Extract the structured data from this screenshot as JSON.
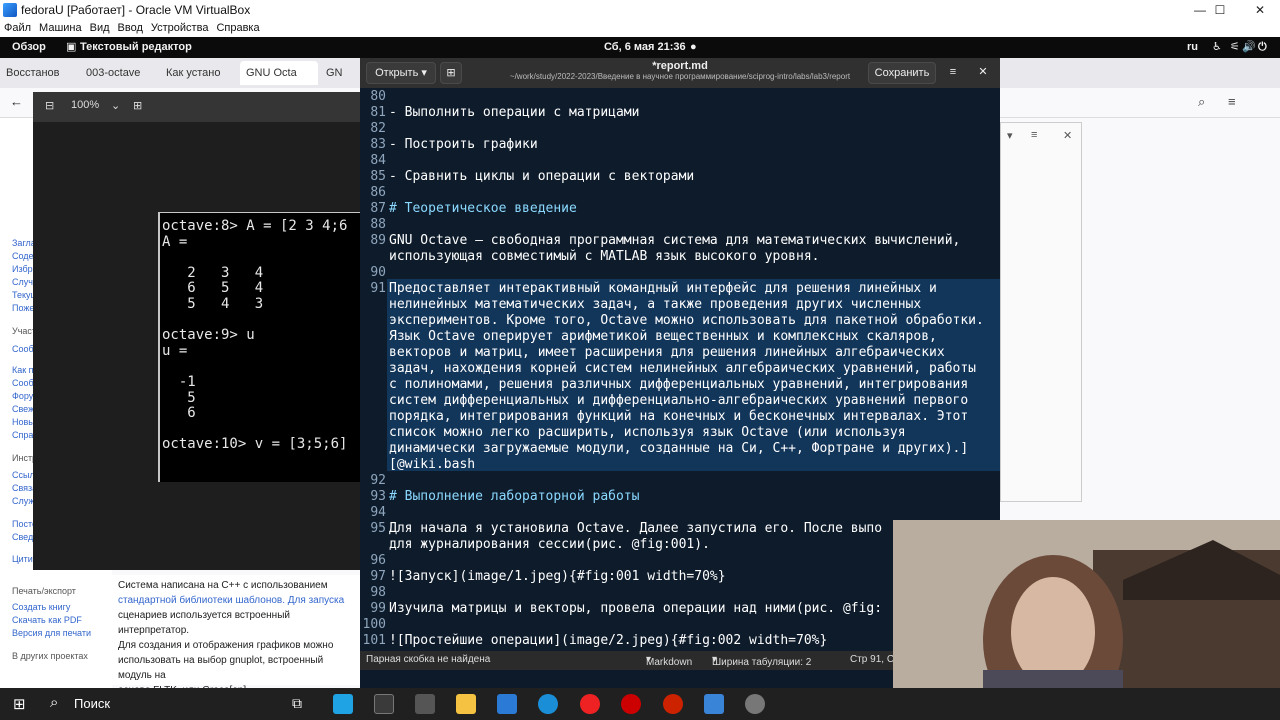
{
  "host": {
    "window_title": "fedoraU [Работает] - Oracle VM VirtualBox",
    "menu": [
      "Файл",
      "Машина",
      "Вид",
      "Ввод",
      "Устройства",
      "Справка"
    ]
  },
  "gnome": {
    "activities": "Обзор",
    "app_name": "Текстовый редактор",
    "clock": "Сб, 6 мая  21:36",
    "lang": "ru"
  },
  "firefox": {
    "tabs": [
      "Восстанов",
      "003-octave",
      "Как устано",
      "GNU Octa",
      "GN"
    ],
    "sidebar": [
      "Заглавная",
      "Содержание",
      "Избранные",
      "Случайная",
      "Текущие",
      "Пожертвовать",
      "Участие",
      "Сообщить",
      "Как править",
      "Сообщество",
      "Форум",
      "Свежие",
      "Новые",
      "Справка",
      "Инструменты",
      "Ссылки сюда",
      "Связанные",
      "Служебные",
      "Постоянная",
      "Сведения",
      "Цитировать",
      "Печать/экспорт",
      "Создать книгу",
      "Скачать как PDF",
      "Версия для печати",
      "В других проектах"
    ],
    "content_lines": [
      "Система написана на C++ с использованием",
      "стандартной библиотеки шаблонов. Для запуска",
      "сценариев используется встроенный интерпретатор.",
      "Для создания и отображения графиков можно",
      "использовать на выбор gnuplot, встроенный модуль на",
      "основе FLTK, или Grace[en]."
    ]
  },
  "viewer": {
    "zoom": "100%",
    "octave_text": "octave:8> A = [2 3 4;6\nA =\n\n   2   3   4\n   6   5   4\n   5   4   3\n\noctave:9> u\nu =\n\n  -1\n   5\n   6\n\noctave:10> v = [3;5;6]"
  },
  "gedit": {
    "open_label": "Открыть",
    "title": "*report.md",
    "path": "~/work/study/2022-2023/Введение в научное программирование/sciprog-intro/labs/lab3/report",
    "save_label": "Сохранить",
    "lines": [
      {
        "n": "80",
        "t": ""
      },
      {
        "n": "81",
        "t": "- Выполнить операции с матрицами"
      },
      {
        "n": "82",
        "t": ""
      },
      {
        "n": "83",
        "t": "- Построить графики"
      },
      {
        "n": "84",
        "t": ""
      },
      {
        "n": "85",
        "t": "- Сравнить циклы и операции с векторами"
      },
      {
        "n": "86",
        "t": ""
      },
      {
        "n": "87",
        "t": "# Теоретическое введение"
      },
      {
        "n": "88",
        "t": ""
      },
      {
        "n": "89",
        "t": "GNU Octave — свободная программная система для математических вычислений,"
      },
      {
        "n": "",
        "t": "использующая совместимый с MATLAB язык высокого уровня."
      },
      {
        "n": "90",
        "t": ""
      },
      {
        "n": "91",
        "t": "Предоставляет интерактивный командный интерфейс для решения линейных и"
      },
      {
        "n": "",
        "t": "нелинейных математических задач, а также проведения других численных"
      },
      {
        "n": "",
        "t": "экспериментов. Кроме того, Octave можно использовать для пакетной обработки."
      },
      {
        "n": "",
        "t": "Язык Octave оперирует арифметикой вещественных и комплексных скаляров,"
      },
      {
        "n": "",
        "t": "векторов и матриц, имеет расширения для решения линейных алгебраических"
      },
      {
        "n": "",
        "t": "задач, нахождения корней систем нелинейных алгебраических уравнений, работы"
      },
      {
        "n": "",
        "t": "с полиномами, решения различных дифференциальных уравнений, интегрирования"
      },
      {
        "n": "",
        "t": "систем дифференциальных и дифференциально-алгебраических уравнений первого"
      },
      {
        "n": "",
        "t": "порядка, интегрирования функций на конечных и бесконечных интервалах. Этот"
      },
      {
        "n": "",
        "t": "список можно легко расширить, используя язык Octave (или используя"
      },
      {
        "n": "",
        "t": "динамически загружаемые модули, созданные на Си, C++, Фортране и других).]"
      },
      {
        "n": "",
        "t": "[@wiki.bash"
      },
      {
        "n": "92",
        "t": ""
      },
      {
        "n": "93",
        "t": "# Выполнение лабораторной работы"
      },
      {
        "n": "94",
        "t": ""
      },
      {
        "n": "95",
        "t": "Для начала я установила Octave. Далее запустила его. После выпо"
      },
      {
        "n": "",
        "t": "для журналирования сессии(рис. @fig:001)."
      },
      {
        "n": "96",
        "t": ""
      },
      {
        "n": "97",
        "t": "![Запуск](image/1.jpeg){#fig:001 width=70%}"
      },
      {
        "n": "98",
        "t": ""
      },
      {
        "n": "99",
        "t": "Изучила матрицы и векторы, провела операции над ними(рис. @fig:"
      },
      {
        "n": "100",
        "t": ""
      },
      {
        "n": "101",
        "t": "![Простейшие операции](image/2.jpeg){#fig:002 width=70%}"
      }
    ],
    "status_left": "Парная скобка не найдена",
    "status_lang": "Markdown",
    "status_tab": "Ширина табуляции: 2",
    "status_pos": "Стр 91, Ст"
  },
  "taskbar": {
    "search": "Поиск"
  }
}
